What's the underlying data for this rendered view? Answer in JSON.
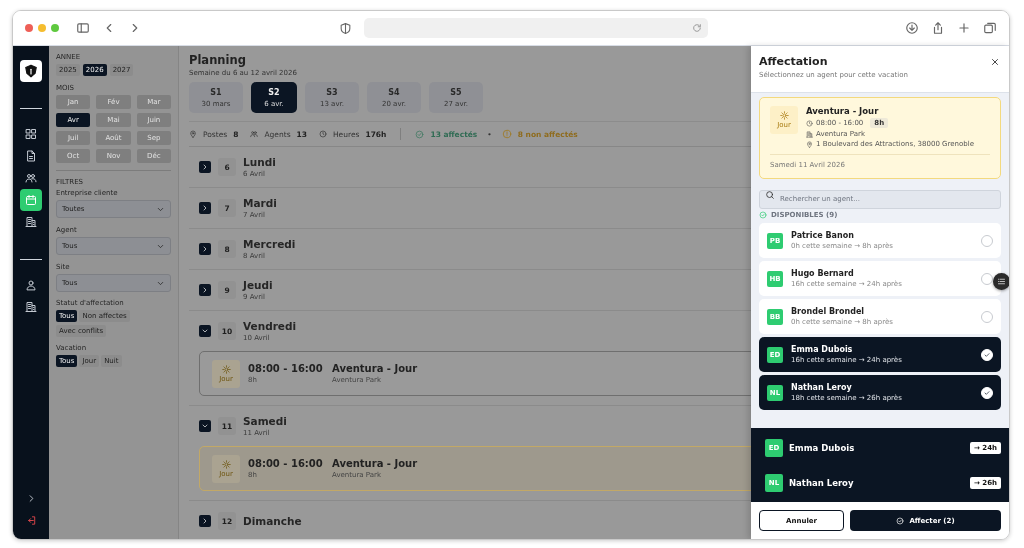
{
  "nav": {
    "items": [
      {
        "kind": "grid",
        "selected": false
      },
      {
        "kind": "document",
        "selected": false
      },
      {
        "kind": "users",
        "selected": false
      },
      {
        "kind": "calendar",
        "selected": true
      },
      {
        "kind": "building",
        "selected": false
      }
    ],
    "account_items": [
      {
        "kind": "user",
        "selected": false
      },
      {
        "kind": "building",
        "selected": false
      }
    ],
    "bottom_items": [
      {
        "kind": "expand"
      },
      {
        "kind": "logout"
      }
    ]
  },
  "filters": {
    "year_label": "ANNEE",
    "years": [
      {
        "label": "2025",
        "selected": false
      },
      {
        "label": "2026",
        "selected": true
      },
      {
        "label": "2027",
        "selected": false
      }
    ],
    "month_label": "MOIS",
    "months": [
      {
        "label": "Jan",
        "selected": false,
        "disabled": true
      },
      {
        "label": "Fév",
        "selected": false,
        "disabled": true
      },
      {
        "label": "Mar",
        "selected": false,
        "disabled": true
      },
      {
        "label": "Avr",
        "selected": true,
        "disabled": false
      },
      {
        "label": "Mai",
        "selected": false,
        "disabled": true
      },
      {
        "label": "Juin",
        "selected": false,
        "disabled": true
      },
      {
        "label": "Juil",
        "selected": false,
        "disabled": true
      },
      {
        "label": "Août",
        "selected": false,
        "disabled": true
      },
      {
        "label": "Sep",
        "selected": false,
        "disabled": true
      },
      {
        "label": "Oct",
        "selected": false,
        "disabled": true
      },
      {
        "label": "Nov",
        "selected": false,
        "disabled": true
      },
      {
        "label": "Déc",
        "selected": false,
        "disabled": true
      }
    ],
    "title": "FILTRES",
    "selects": [
      {
        "label": "Entreprise cliente",
        "value": "Toutes"
      },
      {
        "label": "Agent",
        "value": "Tous"
      },
      {
        "label": "Site",
        "value": "Tous"
      }
    ],
    "chip_groups": [
      {
        "label": "Statut d'affectation",
        "chips": [
          {
            "label": "Tous",
            "selected": true
          },
          {
            "label": "Non affectes",
            "selected": false
          },
          {
            "label": "Avec conflits",
            "selected": false
          }
        ]
      },
      {
        "label": "Vacation",
        "chips": [
          {
            "label": "Tous",
            "selected": true
          },
          {
            "label": "Jour",
            "selected": false
          },
          {
            "label": "Nuit",
            "selected": false
          }
        ]
      }
    ]
  },
  "planning": {
    "title": "Planning",
    "subtitle": "Semaine du 6 au 12 avril 2026",
    "weeks": [
      {
        "label": "S1",
        "date": "30 mars",
        "selected": false
      },
      {
        "label": "S2",
        "date": "6 avr.",
        "selected": true
      },
      {
        "label": "S3",
        "date": "13 avr.",
        "selected": false
      },
      {
        "label": "S4",
        "date": "20 avr.",
        "selected": false
      },
      {
        "label": "S5",
        "date": "27 avr.",
        "selected": false
      }
    ],
    "stats": [
      {
        "kind": "pin",
        "label": "Postes",
        "value": "8"
      },
      {
        "kind": "users",
        "label": "Agents",
        "value": "13"
      },
      {
        "kind": "clock",
        "label": "Heures",
        "value": "176h"
      }
    ],
    "assigned": "13 affectés",
    "separator": "•",
    "unassigned": "8 non affectés",
    "days": [
      {
        "number": "6",
        "name": "Lundi",
        "date": "6 Avril",
        "expanded": false
      },
      {
        "number": "7",
        "name": "Mardi",
        "date": "7 Avril",
        "expanded": false
      },
      {
        "number": "8",
        "name": "Mercredi",
        "date": "8 Avril",
        "expanded": false
      },
      {
        "number": "9",
        "name": "Jeudi",
        "date": "9 Avril",
        "expanded": false
      },
      {
        "number": "10",
        "name": "Vendredi",
        "date": "10 Avril",
        "expanded": true,
        "shifts": [
          {
            "badge": "Jour",
            "time": "08:00 - 16:00",
            "duration": "8h",
            "title": "Aventura - Jour",
            "site": "Aventura Park",
            "selected": false
          }
        ]
      },
      {
        "number": "11",
        "name": "Samedi",
        "date": "11 Avril",
        "expanded": true,
        "shifts": [
          {
            "badge": "Jour",
            "time": "08:00 - 16:00",
            "duration": "8h",
            "title": "Aventura - Jour",
            "site": "Aventura Park",
            "selected": true
          }
        ]
      },
      {
        "number": "12",
        "name": "Dimanche",
        "expanded": false
      }
    ]
  },
  "drawer": {
    "title": "Affectation",
    "subtitle": "Sélectionnez un agent pour cette vacation",
    "shift": {
      "badge": "Jour",
      "title": "Aventura - Jour",
      "time": "08:00 - 16:00",
      "duration": "8h",
      "site": "Aventura Park",
      "address": "1 Boulevard des Attractions, 38000 Grenoble",
      "date": "Samedi 11 Avril 2026"
    },
    "search": {
      "placeholder": "Rechercher un agent..."
    },
    "available_label": "DISPONIBLES (9)",
    "agents": [
      {
        "initials": "PB",
        "name": "Patrice Banon",
        "hours": "0h cette semaine → 8h après",
        "selected": false
      },
      {
        "initials": "HB",
        "name": "Hugo Bernard",
        "hours": "16h cette semaine → 24h après",
        "selected": false
      },
      {
        "initials": "BB",
        "name": "Brondel Brondel",
        "hours": "0h cette semaine → 8h après",
        "selected": false
      },
      {
        "initials": "ED",
        "name": "Emma Dubois",
        "hours": "16h cette semaine → 24h après",
        "selected": true
      },
      {
        "initials": "NL",
        "name": "Nathan Leroy",
        "hours": "18h cette semaine → 26h après",
        "selected": true
      }
    ],
    "summary": [
      {
        "initials": "ED",
        "name": "Emma Dubois",
        "total": "→ 24h"
      },
      {
        "initials": "NL",
        "name": "Nathan Leroy",
        "total": "→ 26h"
      }
    ],
    "cancel": "Annuler",
    "confirm": "Affecter (2)"
  }
}
